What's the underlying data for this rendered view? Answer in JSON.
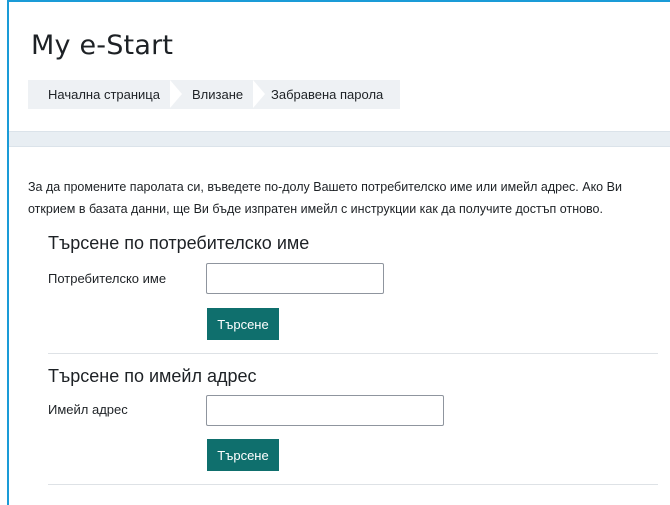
{
  "header": {
    "site_title": "My e-Start"
  },
  "breadcrumb": {
    "items": [
      {
        "label": "Начална страница"
      },
      {
        "label": "Влизане"
      },
      {
        "label": "Забравена парола"
      }
    ]
  },
  "main": {
    "instructions": "За да промените паролата си, въведете по-долу Вашето потребителско име или имейл адрес. Ако Ви открием в базата данни, ще Ви бъде изпратен имейл с инструкции как да получите достъп отново.",
    "username_section": {
      "heading": "Търсене по потребителско име",
      "field_label": "Потребителско име",
      "value": "",
      "button_label": "Търсене"
    },
    "email_section": {
      "heading": "Търсене по имейл адрес",
      "field_label": "Имейл адрес",
      "value": "",
      "button_label": "Търсене"
    }
  },
  "colors": {
    "accent_border": "#1a9bd7",
    "button_bg": "#0f6f6d",
    "breadcrumb_bg": "#eef1f4"
  }
}
